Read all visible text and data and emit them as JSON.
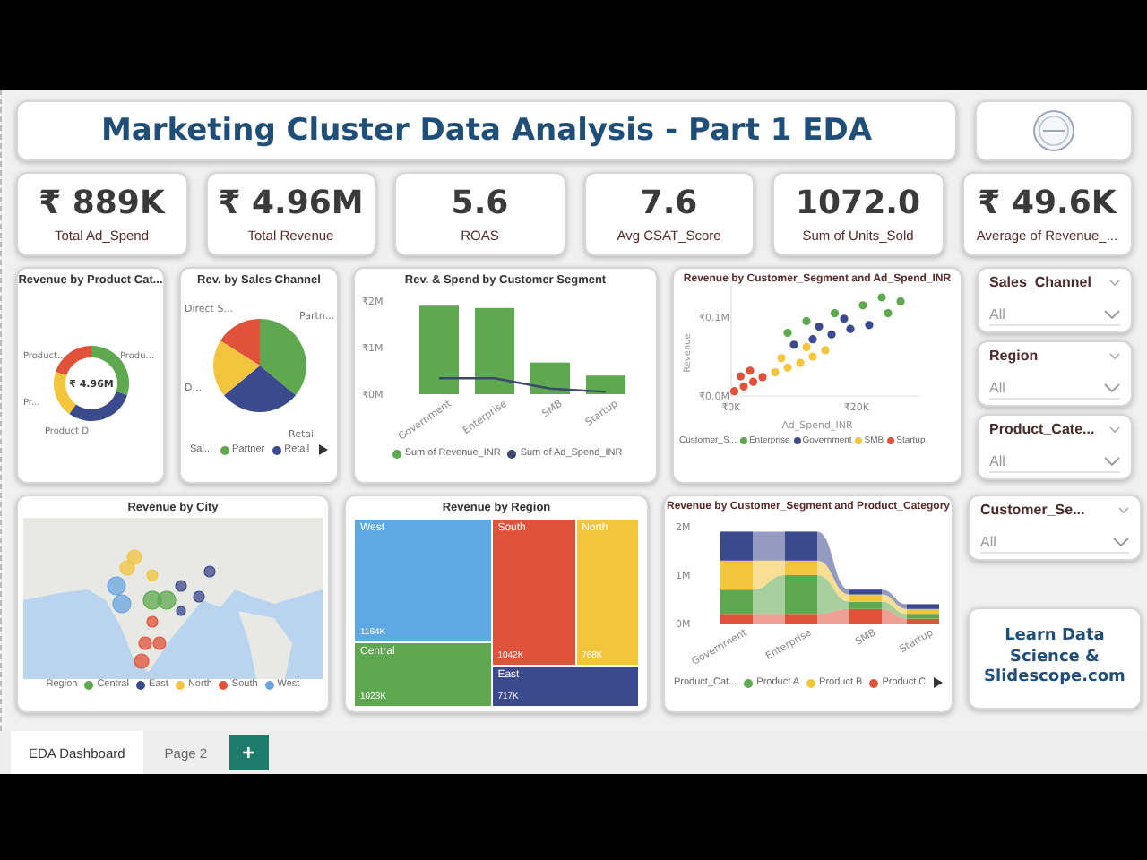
{
  "title": "Marketing Cluster Data Analysis - Part 1 EDA",
  "kpis": [
    {
      "value": "₹ 889K",
      "label": "Total Ad_Spend"
    },
    {
      "value": "₹ 4.96M",
      "label": "Total Revenue"
    },
    {
      "value": "5.6",
      "label": "ROAS"
    },
    {
      "value": "7.6",
      "label": "Avg CSAT_Score"
    },
    {
      "value": "1072.0",
      "label": "Sum of Units_Sold"
    },
    {
      "value": "₹ 49.6K",
      "label": "Average of Revenue_..."
    }
  ],
  "product_donut": {
    "title": "Revenue by Product Cat...",
    "center": "₹ 4.96M",
    "slices": [
      {
        "label": "Product...",
        "color": "#e0533a"
      },
      {
        "label": "Produ...",
        "color": "#5ea84f"
      },
      {
        "label": "Pr...",
        "color": "#f2c53d"
      },
      {
        "label": "Product D",
        "color": "#3b4a8c"
      }
    ]
  },
  "channel_pie": {
    "title": "Rev. by Sales Channel",
    "slices": [
      {
        "label": "Partn...",
        "color": "#5ea84f"
      },
      {
        "label": "Retail",
        "color": "#3b4a8c"
      },
      {
        "label": "D...",
        "color": "#f2c53d"
      },
      {
        "label": "Direct S...",
        "color": "#e0533a"
      }
    ],
    "legend_title": "Sal...",
    "legend": [
      {
        "label": "Partner",
        "color": "#5ea84f"
      },
      {
        "label": "Retail",
        "color": "#3b4a8c"
      }
    ]
  },
  "segment_chart": {
    "chart_data": {
      "type": "bar",
      "title": "Rev. & Spend by Customer Segment",
      "categories": [
        "Government",
        "Enterprise",
        "SMB",
        "Startup"
      ],
      "ylim": [
        0,
        2
      ],
      "legend": "bottom",
      "series": [
        {
          "name": "Sum of Revenue_INR",
          "type": "bar",
          "color": "#5ea84f",
          "values": [
            1.9,
            1.85,
            0.68,
            0.4
          ]
        },
        {
          "name": "Sum of Ad_Spend_INR",
          "type": "line",
          "color": "#3b4a6c",
          "values": [
            0.34,
            0.34,
            0.12,
            0.05
          ]
        }
      ],
      "yticks": [
        {
          "value": 0,
          "label": "₹0M"
        },
        {
          "value": 1,
          "label": "₹1M"
        },
        {
          "value": 2,
          "label": "₹2M"
        }
      ]
    }
  },
  "scatter": {
    "legend_title": "Customer_S...",
    "chart_data": {
      "type": "scatter",
      "title": "Revenue by Customer_Segment and Ad_Spend_INR",
      "xlabel": "Ad_Spend_INR",
      "ylabel": "Revenue",
      "legend": "bottom",
      "xlim": [
        0,
        30
      ],
      "ylim": [
        0,
        0.14
      ],
      "xticks": [
        {
          "value": 0,
          "label": "₹0K"
        },
        {
          "value": 20,
          "label": "₹20K"
        }
      ],
      "yticks": [
        {
          "value": 0,
          "label": "₹0.0M"
        },
        {
          "value": 0.1,
          "label": "₹0.1M"
        }
      ],
      "series": [
        {
          "name": "Enterprise",
          "color": "#5ea84f",
          "x": [
            9,
            12,
            16.5,
            21,
            24,
            27,
            25
          ],
          "values": [
            0.08,
            0.095,
            0.105,
            0.115,
            0.125,
            0.12,
            0.105
          ]
        },
        {
          "name": "Government",
          "color": "#3b4a8c",
          "x": [
            10,
            13,
            16,
            19,
            22,
            14,
            18
          ],
          "values": [
            0.065,
            0.072,
            0.078,
            0.085,
            0.09,
            0.088,
            0.098
          ]
        },
        {
          "name": "SMB",
          "color": "#f2c53d",
          "x": [
            7,
            9,
            11,
            13,
            15,
            8,
            12
          ],
          "values": [
            0.03,
            0.036,
            0.042,
            0.05,
            0.058,
            0.048,
            0.062
          ]
        },
        {
          "name": "Startup",
          "color": "#e0533a",
          "x": [
            0.5,
            2,
            3.5,
            5,
            1.5,
            3
          ],
          "values": [
            0.006,
            0.012,
            0.018,
            0.024,
            0.025,
            0.032
          ]
        }
      ]
    }
  },
  "slicers_top": [
    {
      "label": "Sales_Channel",
      "value": "All"
    },
    {
      "label": "Region",
      "value": "All"
    },
    {
      "label": "Product_Cate...",
      "value": "All"
    }
  ],
  "map": {
    "title": "Revenue by City",
    "legend_title": "Region",
    "legend": [
      {
        "label": "Central",
        "color": "#5ea84f"
      },
      {
        "label": "East",
        "color": "#3b4a8c"
      },
      {
        "label": "North",
        "color": "#f2c53d"
      },
      {
        "label": "South",
        "color": "#e0533a"
      },
      {
        "label": "West",
        "color": "#6aa6e0"
      }
    ]
  },
  "treemap": {
    "title": "Revenue by Region",
    "tiles": [
      {
        "name": "West",
        "value": "1164K",
        "color": "#5fa8e6"
      },
      {
        "name": "Central",
        "value": "1023K",
        "color": "#5ea84f"
      },
      {
        "name": "South",
        "value": "1042K",
        "color": "#e0533a"
      },
      {
        "name": "North",
        "value": "768K",
        "color": "#f2c53d"
      },
      {
        "name": "East",
        "value": "717K",
        "color": "#3b4a8c"
      }
    ]
  },
  "ribbon": {
    "title": "Revenue by Customer_Segment and Product_Category",
    "y_labels": [
      "2M",
      "1M",
      "0M"
    ],
    "categories": [
      "Government",
      "Enterprise",
      "SMB",
      "Startup"
    ],
    "legend_title": "Product_Cat...",
    "legend": [
      {
        "label": "Product A",
        "color": "#5ea84f"
      },
      {
        "label": "Product B",
        "color": "#f2c53d"
      },
      {
        "label": "Product C",
        "color": "#e0533a"
      }
    ]
  },
  "slicer_bottom": {
    "label": "Customer_Se...",
    "value": "All"
  },
  "promo": "Learn Data Science & Slidescope.com",
  "tabs": [
    {
      "label": "EDA Dashboard",
      "selected": true
    },
    {
      "label": "Page 2",
      "selected": false
    }
  ],
  "add_page": "+"
}
